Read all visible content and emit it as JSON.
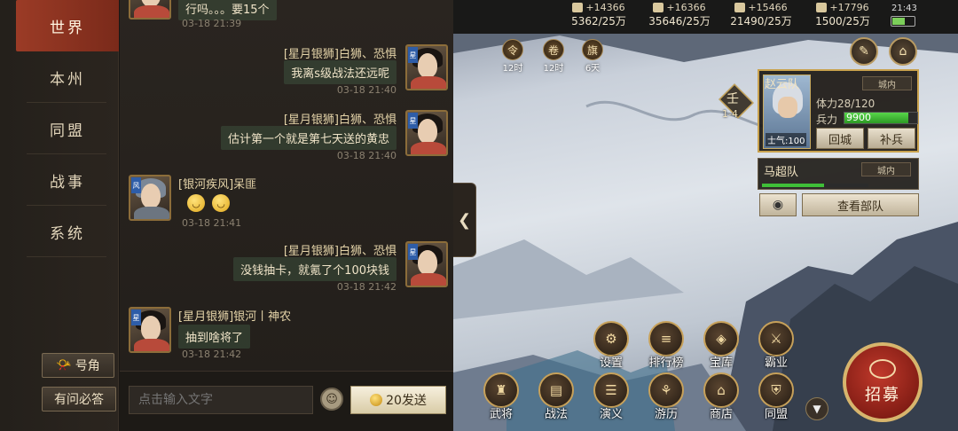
{
  "nav": {
    "items": [
      "世界",
      "本州",
      "同盟",
      "战事",
      "系统"
    ],
    "btn_account": "号角",
    "btn_faq": "有问必答"
  },
  "chat": {
    "top_partial": {
      "text": "行吗。。。要15个",
      "time": "03-18 21:39"
    },
    "messages": [
      {
        "sender": "[星月银狮]白狮、恐惧",
        "text": "我离s级战法还远呢",
        "time": "03-18 21:40",
        "side": "right"
      },
      {
        "sender": "[星月银狮]白狮、恐惧",
        "text": "估计第一个就是第七天送的黄忠",
        "time": "03-18 21:40",
        "side": "right"
      },
      {
        "sender": "[银河疾风]呆匪",
        "text": "",
        "time": "03-18 21:41",
        "side": "left"
      },
      {
        "sender": "[星月银狮]白狮、恐惧",
        "text": "没钱抽卡，就氪了个100块钱",
        "time": "03-18 21:42",
        "side": "right"
      },
      {
        "sender": "[星月银狮]银河丨神农",
        "text": "抽到啥将了",
        "time": "03-18 21:42",
        "side": "left"
      }
    ],
    "input_placeholder": "点击输入文字",
    "send_label": "20发送"
  },
  "resources": [
    {
      "inc": "+14366",
      "amt": "5362/25万"
    },
    {
      "inc": "+16366",
      "amt": "35646/25万"
    },
    {
      "inc": "+15466",
      "amt": "21490/25万"
    },
    {
      "inc": "+17796",
      "amt": "1500/25万"
    }
  ],
  "clock": "21:43",
  "timers": [
    "12时",
    "12时",
    "6天"
  ],
  "city": {
    "glyph": "壬",
    "coord": "1-4"
  },
  "army": {
    "name": "赵云队",
    "status": "城内",
    "stamina": "体力28/120",
    "troops_label": "兵力",
    "troops": "9900",
    "troops_fill": 0.88,
    "morale": "士气:100",
    "btn_return": "回城",
    "btn_replenish": "补兵"
  },
  "army2": {
    "name": "马超队",
    "status": "城内",
    "fill": 0.58
  },
  "view_army": "查看部队",
  "menu": {
    "row1": [
      "设置",
      "排行榜",
      "宝库",
      "霸业"
    ],
    "row2": [
      "武将",
      "战法",
      "演义",
      "游历",
      "商店",
      "同盟"
    ],
    "recruit": "招募"
  }
}
